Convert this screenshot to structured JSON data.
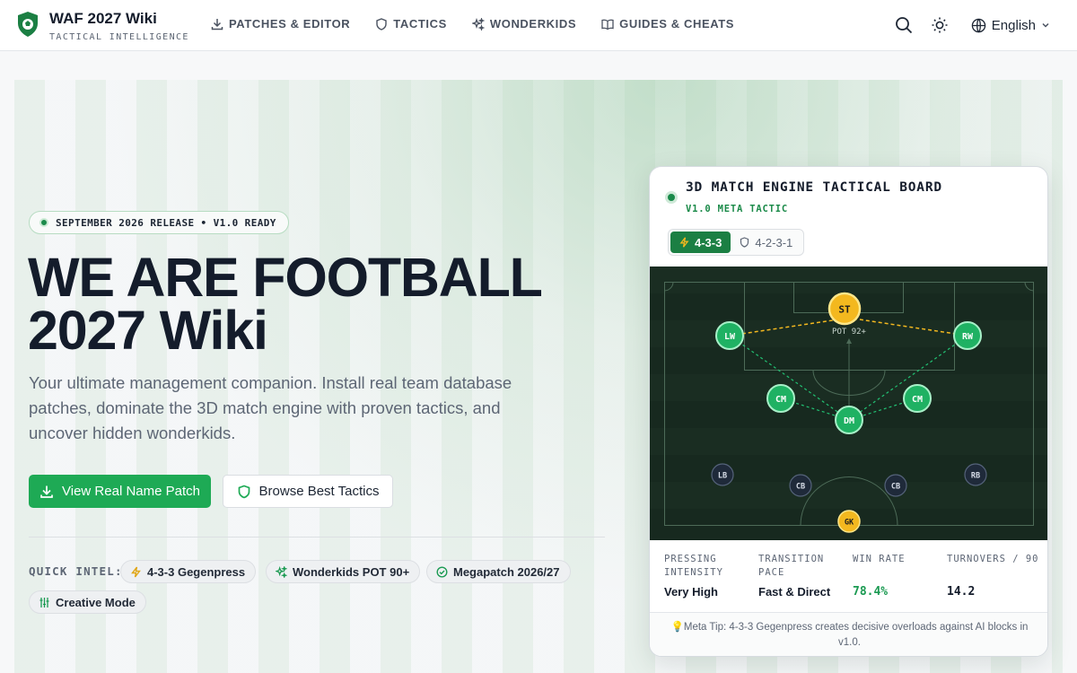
{
  "nav": {
    "brand_title": "WAF 2027 Wiki",
    "brand_subtitle": "TACTICAL INTELLIGENCE",
    "links": [
      {
        "label": "PATCHES & EDITOR",
        "icon": "download-icon"
      },
      {
        "label": "TACTICS",
        "icon": "shield-icon"
      },
      {
        "label": "WONDERKIDS",
        "icon": "sparkles-icon"
      },
      {
        "label": "GUIDES & CHEATS",
        "icon": "book-icon"
      }
    ],
    "language": "English",
    "icons": [
      "search-icon",
      "sun-icon",
      "globe-icon",
      "chevron-down-icon"
    ]
  },
  "hero": {
    "release_badge": "SEPTEMBER 2026 RELEASE • V1.0 READY",
    "title_line1": "WE ARE FOOTBALL",
    "title_line2": "2027 Wiki",
    "lead": "Your ultimate management companion. Install real team database patches, dominate the 3D match engine with proven tactics, and uncover hidden wonderkids.",
    "primary_button": "View Real Name Patch",
    "secondary_button": "Browse Best Tactics",
    "quick_intel_label": "QUICK INTEL:",
    "chips": [
      {
        "label": "4-3-3 Gegenpress",
        "icon": "bolt-icon"
      },
      {
        "label": "Wonderkids POT 90+",
        "icon": "sparkles-icon"
      },
      {
        "label": "Megapatch 2026/27",
        "icon": "check-circle-icon"
      },
      {
        "label": "Creative Mode",
        "icon": "sliders-icon"
      }
    ]
  },
  "card": {
    "title": "3D MATCH ENGINE TACTICAL BOARD",
    "subtitle": "V1.0 META TACTIC",
    "tabs": [
      {
        "label": "4-3-3",
        "active": true
      },
      {
        "label": "4-2-3-1",
        "active": false
      }
    ],
    "players": {
      "st": "ST",
      "st_caption": "POT 92+",
      "lw": "LW",
      "rw": "RW",
      "cm_left": "CM",
      "cm_right": "CM",
      "dm": "DM",
      "lb": "LB",
      "cb_left": "CB",
      "cb_right": "CB",
      "rb": "RB",
      "gk": "GK"
    },
    "stats": [
      {
        "label": "PRESSING INTENSITY",
        "value": "Very High"
      },
      {
        "label": "TRANSITION PACE",
        "value": "Fast & Direct"
      },
      {
        "label": "WIN RATE",
        "value": "78.4%"
      },
      {
        "label": "TURNOVERS / 90",
        "value": "14.2"
      }
    ],
    "tip": "💡Meta Tip: 4-3-3 Gegenpress creates decisive overloads against AI blocks in v1.0."
  },
  "colors": {
    "accent_green": "#1eaa55",
    "dark_green": "#1b7f43",
    "gold": "#f3b81f",
    "pitch": "#17291f"
  }
}
